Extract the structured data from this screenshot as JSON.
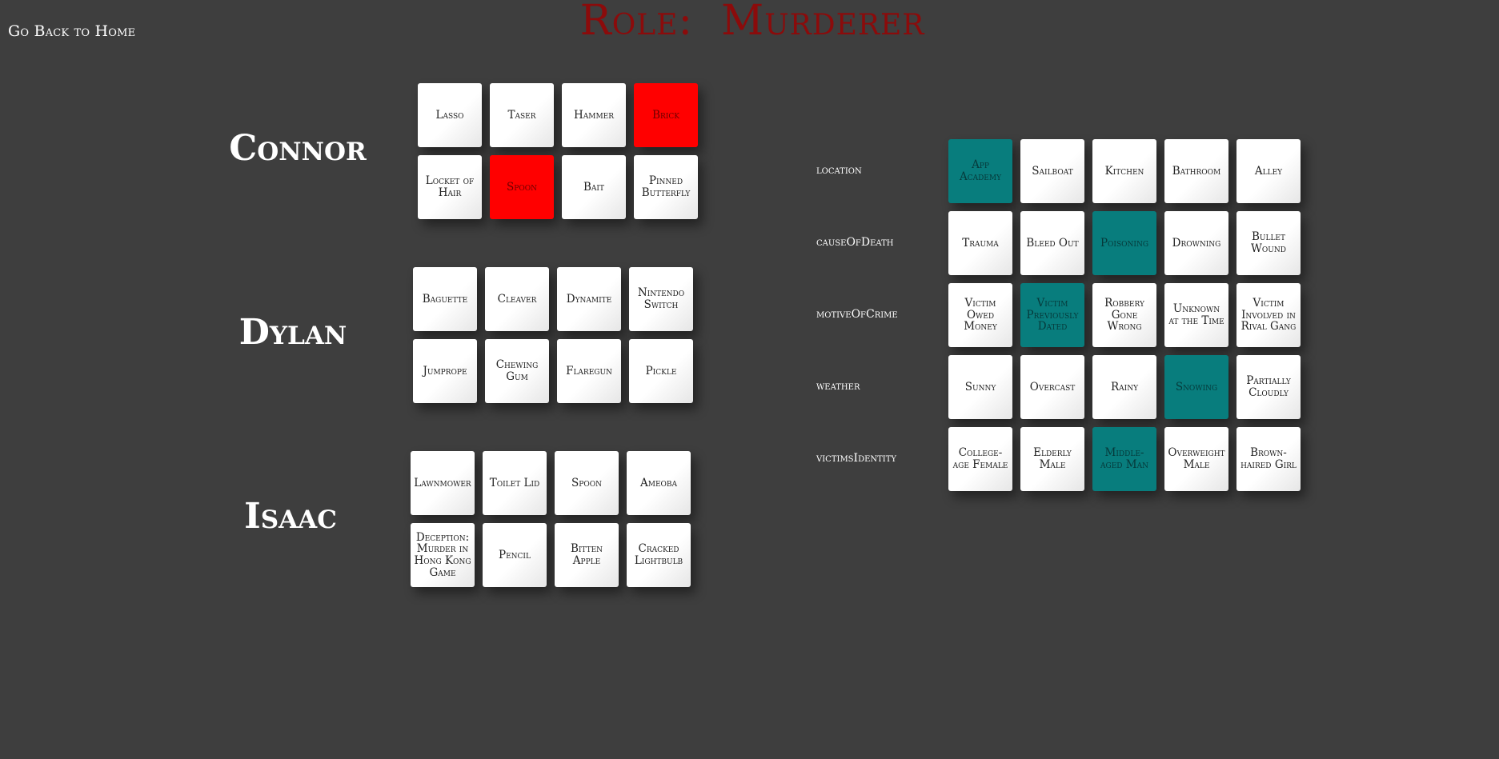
{
  "home_link": "Go Back to Home",
  "role_title": "Role:  Murderer",
  "players": [
    {
      "name": "Connor",
      "cards": [
        {
          "label": "Lasso",
          "state": "none"
        },
        {
          "label": "Taser",
          "state": "none"
        },
        {
          "label": "Hammer",
          "state": "none"
        },
        {
          "label": "Brick",
          "state": "red"
        },
        {
          "label": "Locket of Hair",
          "state": "none"
        },
        {
          "label": "Spoon",
          "state": "red"
        },
        {
          "label": "Bait",
          "state": "none"
        },
        {
          "label": "Pinned Butterfly",
          "state": "none"
        }
      ]
    },
    {
      "name": "Dylan",
      "cards": [
        {
          "label": "Baguette",
          "state": "none"
        },
        {
          "label": "Cleaver",
          "state": "none"
        },
        {
          "label": "Dynamite",
          "state": "none"
        },
        {
          "label": "Nintendo Switch",
          "state": "none"
        },
        {
          "label": "Jumprope",
          "state": "none"
        },
        {
          "label": "Chewing Gum",
          "state": "none"
        },
        {
          "label": "Flaregun",
          "state": "none"
        },
        {
          "label": "Pickle",
          "state": "none"
        }
      ]
    },
    {
      "name": "Isaac",
      "cards": [
        {
          "label": "Lawnmower",
          "state": "none"
        },
        {
          "label": "Toilet Lid",
          "state": "none"
        },
        {
          "label": "Spoon",
          "state": "none"
        },
        {
          "label": "Ameoba",
          "state": "none"
        },
        {
          "label": "Deception: Murder in Hong Kong Game",
          "state": "none"
        },
        {
          "label": "Pencil",
          "state": "none"
        },
        {
          "label": "Bitten Apple",
          "state": "none"
        },
        {
          "label": "Cracked Lightbulb",
          "state": "none"
        }
      ]
    }
  ],
  "clue_categories": [
    {
      "name": "location",
      "options": [
        {
          "label": "App Academy",
          "state": "teal"
        },
        {
          "label": "Sailboat",
          "state": "none"
        },
        {
          "label": "Kitchen",
          "state": "none"
        },
        {
          "label": "Bathroom",
          "state": "none"
        },
        {
          "label": "Alley",
          "state": "none"
        }
      ]
    },
    {
      "name": "causeOfDeath",
      "options": [
        {
          "label": "Trauma",
          "state": "none"
        },
        {
          "label": "Bleed Out",
          "state": "none"
        },
        {
          "label": "Poisoning",
          "state": "teal"
        },
        {
          "label": "Drowning",
          "state": "none"
        },
        {
          "label": "Bullet Wound",
          "state": "none"
        }
      ]
    },
    {
      "name": "motiveOfCrime",
      "options": [
        {
          "label": "Victim Owed Money",
          "state": "none"
        },
        {
          "label": "Victim Previously Dated",
          "state": "teal"
        },
        {
          "label": "Robbery Gone Wrong",
          "state": "none"
        },
        {
          "label": "Unknown at the Time",
          "state": "none"
        },
        {
          "label": "Victim Involved in Rival Gang",
          "state": "none"
        }
      ]
    },
    {
      "name": "weather",
      "options": [
        {
          "label": "Sunny",
          "state": "none"
        },
        {
          "label": "Overcast",
          "state": "none"
        },
        {
          "label": "Rainy",
          "state": "none"
        },
        {
          "label": "Snowing",
          "state": "teal"
        },
        {
          "label": "Partially Cloudly",
          "state": "none"
        }
      ]
    },
    {
      "name": "victimsIdentity",
      "options": [
        {
          "label": "College-age Female",
          "state": "none"
        },
        {
          "label": "Elderly Male",
          "state": "none"
        },
        {
          "label": "Middle-aged Man",
          "state": "teal"
        },
        {
          "label": "Overweight Male",
          "state": "none"
        },
        {
          "label": "Brown-haired Girl",
          "state": "none"
        }
      ]
    }
  ]
}
